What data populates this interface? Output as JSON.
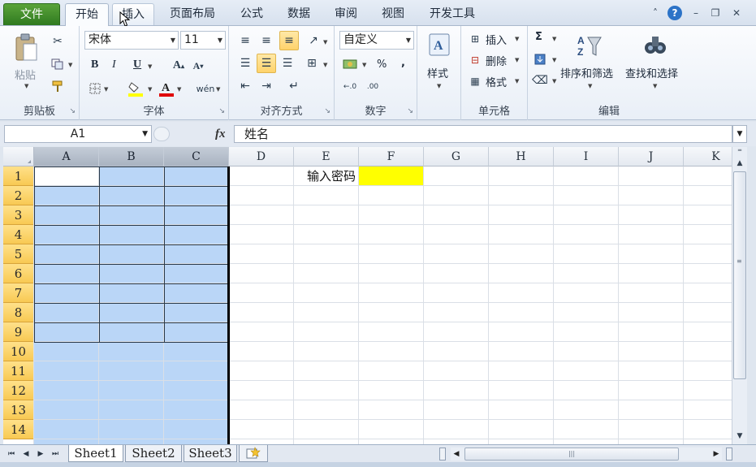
{
  "tabs": {
    "file": "文件",
    "home": "开始",
    "insert": "插入",
    "page_layout": "页面布局",
    "formulas": "公式",
    "data": "数据",
    "review": "审阅",
    "view": "视图",
    "developer": "开发工具"
  },
  "ribbon": {
    "clipboard": {
      "paste": "粘贴",
      "label": "剪贴板"
    },
    "font": {
      "name": "宋体",
      "size": "11",
      "bold": "B",
      "italic": "I",
      "underline": "U",
      "label": "字体"
    },
    "alignment": {
      "label": "对齐方式"
    },
    "number": {
      "format": "自定义",
      "percent": "%",
      "comma": ",",
      "label": "数字"
    },
    "styles": {
      "styles": "样式"
    },
    "cells": {
      "insert": "插入",
      "delete": "删除",
      "format": "格式",
      "label": "单元格"
    },
    "editing": {
      "sum": "Σ",
      "sort_filter": "排序和筛选",
      "find_select": "查找和选择",
      "label": "编辑"
    }
  },
  "formula_bar": {
    "name_box": "A1",
    "fx": "fx",
    "content": "姓名"
  },
  "grid": {
    "columns": [
      "A",
      "B",
      "C",
      "D",
      "E",
      "F",
      "G",
      "H",
      "I",
      "J",
      "K"
    ],
    "rows": [
      "1",
      "2",
      "3",
      "4",
      "5",
      "6",
      "7",
      "8",
      "9",
      "10",
      "11",
      "12",
      "13",
      "14"
    ],
    "cells": {
      "E1": "输入密码"
    },
    "colors": {
      "selection": "#bad6f7",
      "highlight_f1": "#ffff00",
      "row_header": "#f8c953"
    }
  },
  "sheets": [
    "Sheet1",
    "Sheet2",
    "Sheet3"
  ]
}
